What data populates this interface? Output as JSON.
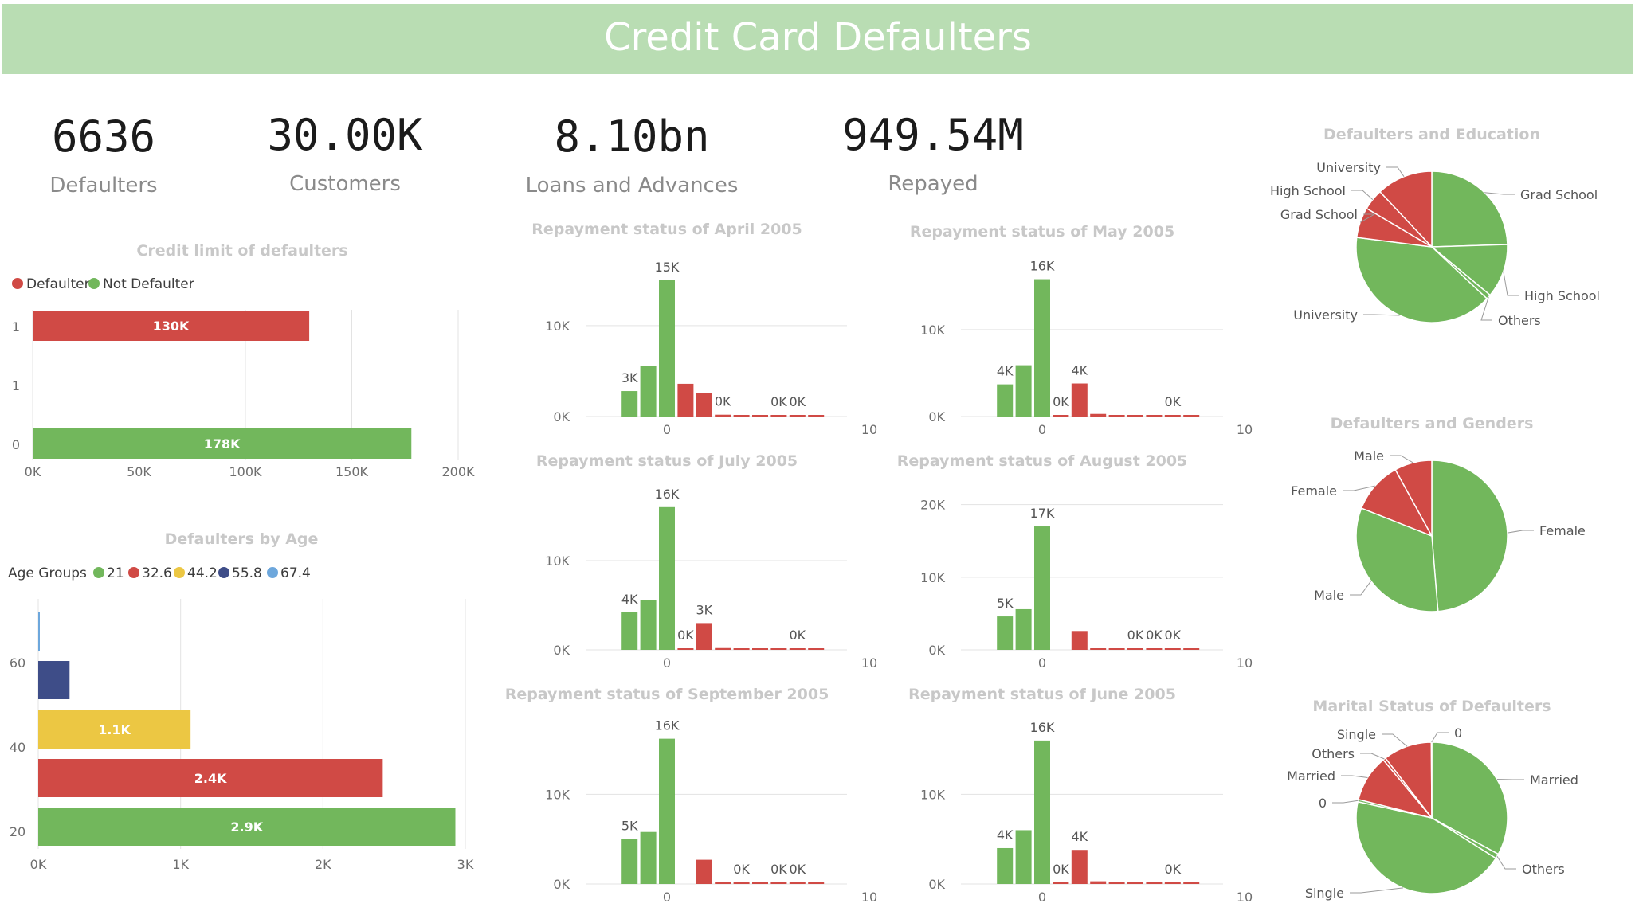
{
  "header": {
    "title": "Credit Card Defaulters"
  },
  "kpis": [
    {
      "value": "6636",
      "label": "Defaulters"
    },
    {
      "value": "30.00K",
      "label": "Customers"
    },
    {
      "value": "8.10bn",
      "label": "Loans and Advances"
    },
    {
      "value": "949.54M",
      "label": "Repayed"
    }
  ],
  "colors": {
    "green": "#72b75c",
    "red": "#d04a45",
    "yellow": "#ecc743",
    "navy": "#3e4d88",
    "blue": "#6da7dc",
    "banner": "#b9ddb3"
  },
  "chart_data": [
    {
      "id": "credit-limit",
      "type": "bar",
      "orientation": "horizontal",
      "title": "Credit limit of defaulters",
      "legend": [
        "Defaulter",
        "Not Defaulter"
      ],
      "legend_position": "top-left",
      "categories": [
        "1",
        "1",
        "0"
      ],
      "bars": [
        {
          "category": "1",
          "series": "Defaulter",
          "value": 130000,
          "label": "130K"
        },
        {
          "category": "0",
          "series": "Not Defaulter",
          "value": 178000,
          "label": "178K"
        }
      ],
      "x_ticks": [
        "0K",
        "50K",
        "100K",
        "150K",
        "200K"
      ],
      "xlim": [
        0,
        200000
      ],
      "grid": true
    },
    {
      "id": "age",
      "type": "bar",
      "orientation": "horizontal",
      "title": "Defaulters by Age",
      "legend_title": "Age Groups",
      "legend": [
        "21",
        "32.6",
        "44.2",
        "55.8",
        "67.4"
      ],
      "legend_position": "top-left",
      "y_ticks": [
        "60",
        "40",
        "20"
      ],
      "bars": [
        {
          "series": "67.4",
          "value": 10,
          "label": ""
        },
        {
          "series": "55.8",
          "value": 220,
          "label": ""
        },
        {
          "series": "44.2",
          "value": 1070,
          "label": "1.1K"
        },
        {
          "series": "32.6",
          "value": 2420,
          "label": "2.4K"
        },
        {
          "series": "21",
          "value": 2930,
          "label": "2.9K"
        }
      ],
      "x_ticks": [
        "0K",
        "1K",
        "2K",
        "3K"
      ],
      "xlim": [
        0,
        3000
      ],
      "grid": true
    },
    {
      "id": "rep-apr",
      "type": "bar",
      "title": "Repayment status of April 2005",
      "x": [
        -2,
        -1,
        0,
        1,
        2,
        3,
        4,
        5,
        6,
        7,
        8
      ],
      "values": [
        2800,
        5600,
        15000,
        3600,
        2600,
        200,
        100,
        100,
        100,
        60,
        40
      ],
      "labels": [
        "3K",
        "",
        "15K",
        "",
        "",
        "0K",
        "",
        "",
        "0K",
        "0K",
        ""
      ],
      "y_ticks": [
        "0K",
        "10K"
      ],
      "ylim": [
        0,
        17000
      ],
      "y_tick_values": [
        0,
        10000
      ],
      "x_ticks": [
        "0",
        "10"
      ],
      "grid": true
    },
    {
      "id": "rep-may",
      "type": "bar",
      "title": "Repayment status of May 2005",
      "x": [
        -2,
        -1,
        0,
        1,
        2,
        3,
        4,
        5,
        6,
        7,
        8
      ],
      "values": [
        3700,
        5900,
        15800,
        50,
        3800,
        300,
        100,
        100,
        100,
        100,
        40
      ],
      "labels": [
        "4K",
        "",
        "16K",
        "0K",
        "4K",
        "",
        "",
        "",
        "",
        "0K",
        ""
      ],
      "y_ticks": [
        "0K",
        "10K"
      ],
      "ylim": [
        0,
        17500
      ],
      "y_tick_values": [
        0,
        10000
      ],
      "x_ticks": [
        "0",
        "10"
      ],
      "grid": true
    },
    {
      "id": "rep-jul",
      "type": "bar",
      "title": "Repayment status of July 2005",
      "x": [
        -2,
        -1,
        0,
        1,
        2,
        3,
        4,
        5,
        6,
        7,
        8
      ],
      "values": [
        4200,
        5600,
        16000,
        30,
        3000,
        200,
        100,
        100,
        100,
        80,
        40
      ],
      "labels": [
        "4K",
        "",
        "16K",
        "0K",
        "3K",
        "",
        "",
        "",
        "",
        "0K",
        ""
      ],
      "y_ticks": [
        "0K",
        "10K"
      ],
      "ylim": [
        0,
        17500
      ],
      "y_tick_values": [
        0,
        10000
      ],
      "x_ticks": [
        "0",
        "10"
      ],
      "grid": true
    },
    {
      "id": "rep-aug",
      "type": "bar",
      "title": "Repayment status of August 2005",
      "x": [
        -2,
        -1,
        0,
        1,
        2,
        3,
        4,
        5,
        6,
        7,
        8
      ],
      "values": [
        4600,
        5600,
        17000,
        0,
        2600,
        150,
        100,
        100,
        100,
        100,
        40
      ],
      "labels": [
        "5K",
        "",
        "17K",
        "",
        "",
        "",
        "",
        "0K",
        "0K",
        "0K",
        ""
      ],
      "y_ticks": [
        "0K",
        "10K",
        "20K"
      ],
      "ylim": [
        0,
        21500
      ],
      "y_tick_values": [
        0,
        10000,
        20000
      ],
      "x_ticks": [
        "0",
        "10"
      ],
      "grid": true
    },
    {
      "id": "rep-sep",
      "type": "bar",
      "title": "Repayment status of September 2005",
      "x": [
        -2,
        -1,
        0,
        1,
        2,
        3,
        4,
        5,
        6,
        7,
        8
      ],
      "values": [
        5000,
        5800,
        16200,
        0,
        2700,
        200,
        100,
        100,
        100,
        100,
        40
      ],
      "labels": [
        "5K",
        "",
        "16K",
        "",
        "",
        "",
        "0K",
        "",
        "0K",
        "0K",
        ""
      ],
      "y_ticks": [
        "0K",
        "10K"
      ],
      "ylim": [
        0,
        17500
      ],
      "y_tick_values": [
        0,
        10000
      ],
      "x_ticks": [
        "0",
        "10"
      ],
      "grid": true
    },
    {
      "id": "rep-jun",
      "type": "bar",
      "title": "Repayment status of June 2005",
      "x": [
        -2,
        -1,
        0,
        1,
        2,
        3,
        4,
        5,
        6,
        7,
        8
      ],
      "values": [
        4000,
        6000,
        16000,
        50,
        3800,
        300,
        100,
        100,
        100,
        100,
        40
      ],
      "labels": [
        "4K",
        "",
        "16K",
        "0K",
        "4K",
        "",
        "",
        "",
        "",
        "0K",
        ""
      ],
      "y_ticks": [
        "0K",
        "10K"
      ],
      "ylim": [
        0,
        17500
      ],
      "y_tick_values": [
        0,
        10000
      ],
      "x_ticks": [
        "0",
        "10"
      ],
      "grid": true
    },
    {
      "id": "pie-edu",
      "type": "pie",
      "title": "Defaulters and Education",
      "slices": [
        {
          "label": "Grad School",
          "value": 24.5,
          "color": "green"
        },
        {
          "label": "High School",
          "value": 11.5,
          "color": "green"
        },
        {
          "label": "Others",
          "value": 1.0,
          "color": "green"
        },
        {
          "label": "University",
          "value": 40.0,
          "color": "green"
        },
        {
          "label": "Grad School",
          "value": 6.5,
          "color": "red"
        },
        {
          "label": "High School",
          "value": 4.5,
          "color": "red"
        },
        {
          "label": "University",
          "value": 12.0,
          "color": "red"
        }
      ]
    },
    {
      "id": "pie-gender",
      "type": "pie",
      "title": "Defaulters and Genders",
      "slices": [
        {
          "label": "Female",
          "value": 48.7,
          "color": "green"
        },
        {
          "label": "Male",
          "value": 32.3,
          "color": "green"
        },
        {
          "label": "Female",
          "value": 11.0,
          "color": "red"
        },
        {
          "label": "Male",
          "value": 8.0,
          "color": "red"
        }
      ]
    },
    {
      "id": "pie-marital",
      "type": "pie",
      "title": "Marital Status of Defaulters",
      "slices": [
        {
          "label": "Married",
          "value": 33.0,
          "color": "green"
        },
        {
          "label": "Others",
          "value": 1.0,
          "color": "green"
        },
        {
          "label": "Single",
          "value": 44.5,
          "color": "green"
        },
        {
          "label": "0",
          "value": 0.5,
          "color": "green"
        },
        {
          "label": "Married",
          "value": 10.0,
          "color": "red"
        },
        {
          "label": "Others",
          "value": 0.6,
          "color": "red"
        },
        {
          "label": "Single",
          "value": 10.4,
          "color": "red"
        },
        {
          "label": "0",
          "value": 0.1,
          "color": "red"
        }
      ]
    }
  ]
}
